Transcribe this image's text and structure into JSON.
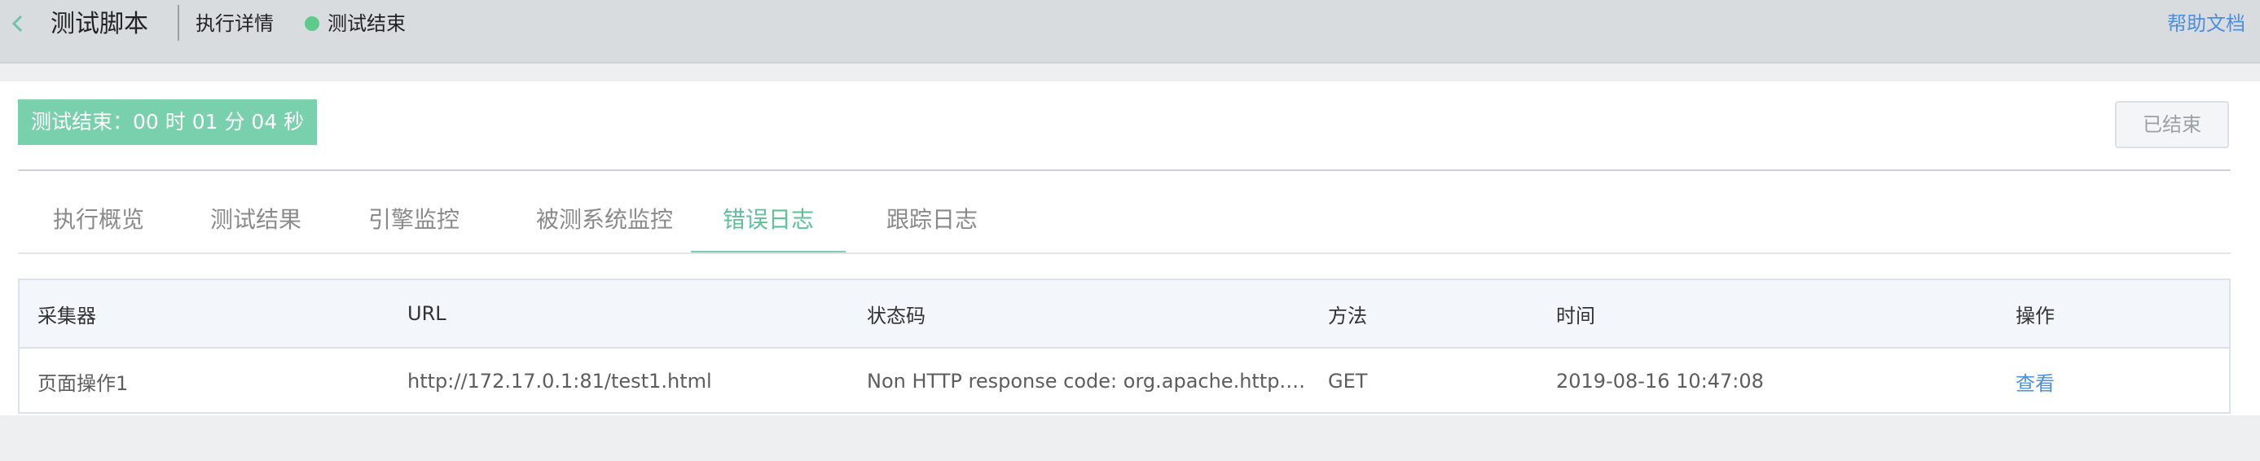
{
  "header": {
    "back_icon": "chevron-left-icon",
    "title": "测试脚本",
    "detail_label": "执行详情",
    "status_text": "测试结束",
    "status_color": "#5fcb8b",
    "help_link": "帮助文档"
  },
  "summary": {
    "timer_text": "测试结束：00 时 01 分 04 秒",
    "finished_button": "已结束"
  },
  "tabs": [
    {
      "label": "执行概览"
    },
    {
      "label": "测试结果"
    },
    {
      "label": "引擎监控"
    },
    {
      "label": "被测系统监控"
    },
    {
      "label": "错误日志",
      "active": true
    },
    {
      "label": "跟踪日志"
    }
  ],
  "table": {
    "columns": [
      "采集器",
      "URL",
      "状态码",
      "方法",
      "时间",
      "操作"
    ],
    "rows": [
      {
        "collector": "页面操作1",
        "url": "http://172.17.0.1:81/test1.html",
        "status_code": "Non HTTP response code: org.apache.http.c…",
        "method": "GET",
        "time": "2019-08-16 10:47:08",
        "action": "查看"
      }
    ]
  },
  "colors": {
    "accent": "#79d0ad",
    "link": "#4a90e2"
  }
}
